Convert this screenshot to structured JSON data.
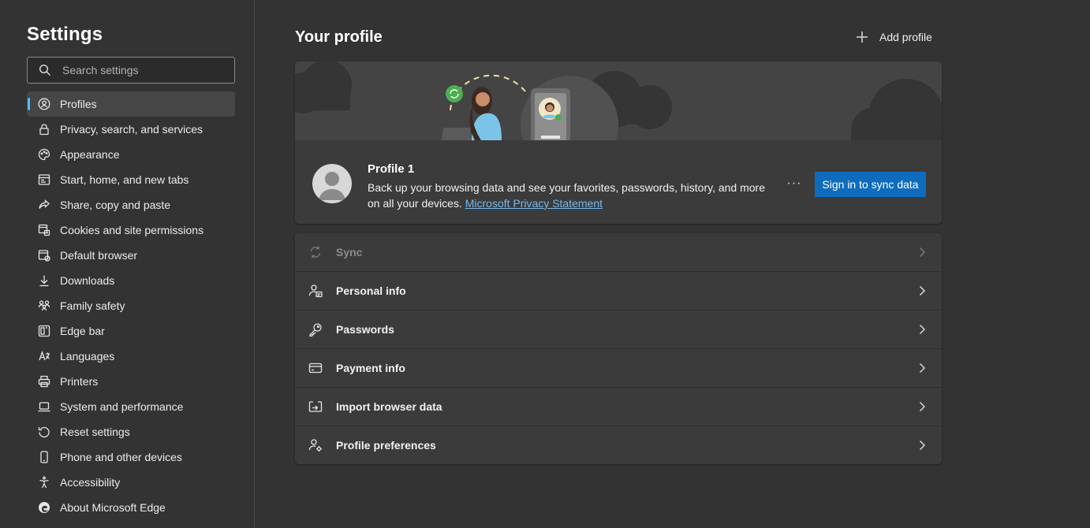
{
  "sidebar": {
    "title": "Settings",
    "search_placeholder": "Search settings",
    "items": [
      {
        "label": "Profiles",
        "icon": "profile-icon",
        "active": true
      },
      {
        "label": "Privacy, search, and services",
        "icon": "lock-icon"
      },
      {
        "label": "Appearance",
        "icon": "palette-icon"
      },
      {
        "label": "Start, home, and new tabs",
        "icon": "home-tabs-icon"
      },
      {
        "label": "Share, copy and paste",
        "icon": "share-icon"
      },
      {
        "label": "Cookies and site permissions",
        "icon": "cookies-icon"
      },
      {
        "label": "Default browser",
        "icon": "default-browser-icon"
      },
      {
        "label": "Downloads",
        "icon": "download-icon"
      },
      {
        "label": "Family safety",
        "icon": "family-icon"
      },
      {
        "label": "Edge bar",
        "icon": "edge-bar-icon"
      },
      {
        "label": "Languages",
        "icon": "languages-icon"
      },
      {
        "label": "Printers",
        "icon": "printer-icon"
      },
      {
        "label": "System and performance",
        "icon": "laptop-icon"
      },
      {
        "label": "Reset settings",
        "icon": "reset-icon"
      },
      {
        "label": "Phone and other devices",
        "icon": "phone-icon"
      },
      {
        "label": "Accessibility",
        "icon": "accessibility-icon"
      },
      {
        "label": "About Microsoft Edge",
        "icon": "edge-logo-icon"
      }
    ]
  },
  "main": {
    "title": "Your profile",
    "add_profile_label": "Add profile",
    "profile": {
      "name": "Profile 1",
      "description": "Back up your browsing data and see your favorites, passwords, history, and more on all your devices.",
      "privacy_link": "Microsoft Privacy Statement",
      "more_label": "···",
      "sync_button_label": "Sign in to sync data"
    },
    "rows": [
      {
        "label": "Sync",
        "icon": "sync-icon",
        "disabled": true
      },
      {
        "label": "Personal info",
        "icon": "personal-info-icon"
      },
      {
        "label": "Passwords",
        "icon": "key-icon"
      },
      {
        "label": "Payment info",
        "icon": "credit-card-icon"
      },
      {
        "label": "Import browser data",
        "icon": "import-icon"
      },
      {
        "label": "Profile preferences",
        "icon": "profile-preferences-icon"
      }
    ]
  },
  "colors": {
    "background": "#333333",
    "card": "#3b3b3b",
    "accent": "#4cc2ff",
    "button": "#0f6cbd",
    "link": "#76b9ed"
  }
}
